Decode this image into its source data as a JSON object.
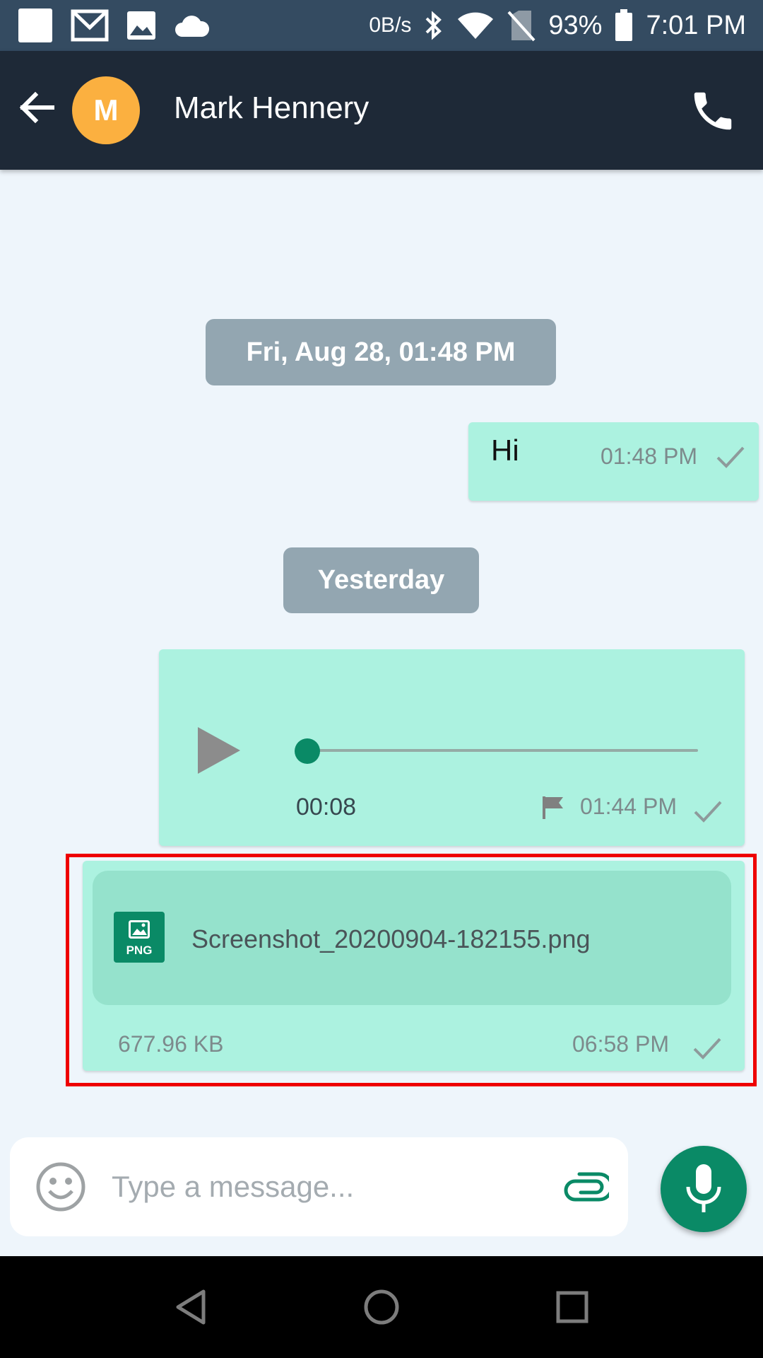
{
  "status_bar": {
    "net_speed": "0B/s",
    "battery": "93%",
    "time": "7:01 PM",
    "icons": [
      "notification-square-icon",
      "gmail-icon",
      "gallery-icon",
      "cloud-icon",
      "bluetooth-icon",
      "wifi-icon",
      "no-sim-icon",
      "battery-icon"
    ]
  },
  "header": {
    "avatar_initial": "M",
    "contact_name": "Mark Hennery",
    "icons": [
      "back-arrow-icon",
      "phone-icon"
    ]
  },
  "chat": {
    "date_chips": [
      "Fri, Aug 28, 01:48 PM",
      "Yesterday"
    ],
    "messages": [
      {
        "type": "text",
        "text": "Hi",
        "time": "01:48 PM"
      },
      {
        "type": "audio",
        "duration": "00:08",
        "progress": 0.0,
        "time": "01:44 PM"
      },
      {
        "type": "file",
        "file_type": "PNG",
        "file_name": "Screenshot_20200904-182155.png",
        "size": "677.96 KB",
        "time": "06:58 PM"
      }
    ]
  },
  "composer": {
    "placeholder": "Type a message...",
    "icons": [
      "emoji-icon",
      "paperclip-icon",
      "microphone-icon"
    ]
  },
  "colors": {
    "status_bar": "#344b61",
    "app_bar": "#1e2937",
    "chat_bg": "#eef5fb",
    "bubble": "#acf2e0",
    "file_card": "#95e2cc",
    "accent": "#0a8a66",
    "avatar": "#fbb040",
    "date_chip": "#93a6b1",
    "highlight": "#ee0000"
  }
}
